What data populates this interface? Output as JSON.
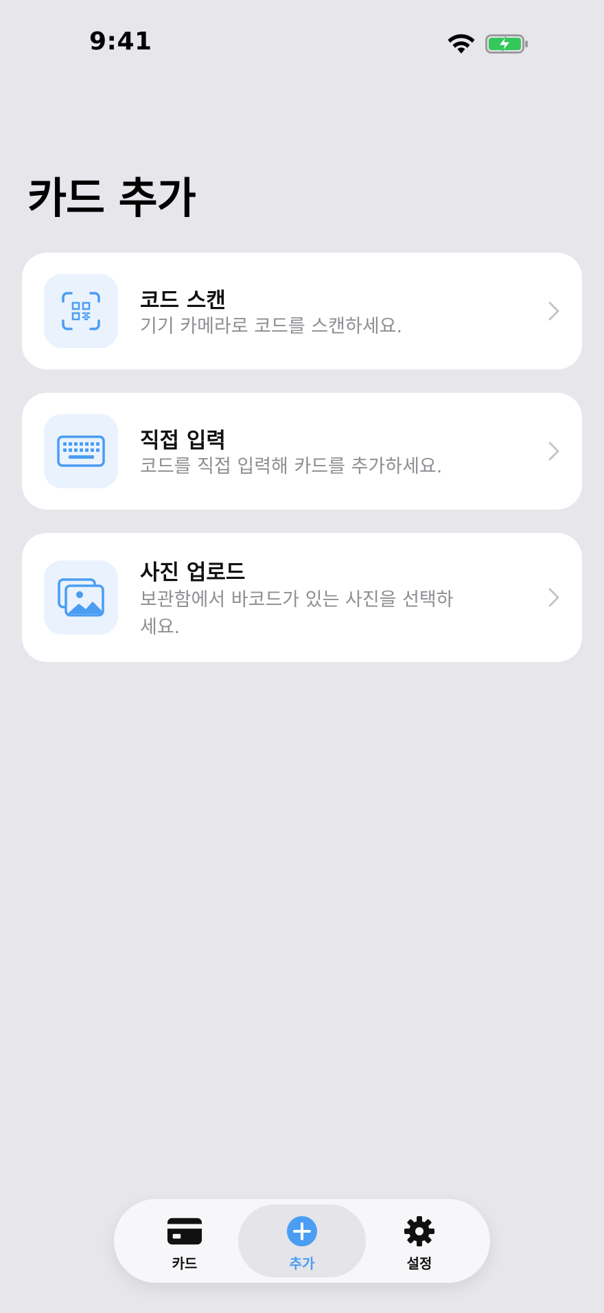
{
  "status_bar": {
    "time": "9:41"
  },
  "page": {
    "title": "카드 추가"
  },
  "options": [
    {
      "title": "코드 스캔",
      "subtitle": "기기 카메라로 코드를 스캔하세요.",
      "icon": "qr-scan-icon"
    },
    {
      "title": "직접 입력",
      "subtitle": "코드를 직접 입력해 카드를 추가하세요.",
      "icon": "keyboard-icon"
    },
    {
      "title": "사진 업로드",
      "subtitle": "보관함에서 바코드가 있는 사진을 선택하세요.",
      "icon": "photos-icon"
    }
  ],
  "tab_bar": {
    "tabs": [
      {
        "label": "카드",
        "icon": "card-icon",
        "active": false
      },
      {
        "label": "추가",
        "icon": "plus-circle-icon",
        "active": true
      },
      {
        "label": "설정",
        "icon": "gear-icon",
        "active": false
      }
    ]
  },
  "colors": {
    "accent": "#4a9df2",
    "background": "#e6e6eb",
    "icon_tile": "#e9f2fd",
    "battery_fill": "#34c759"
  }
}
